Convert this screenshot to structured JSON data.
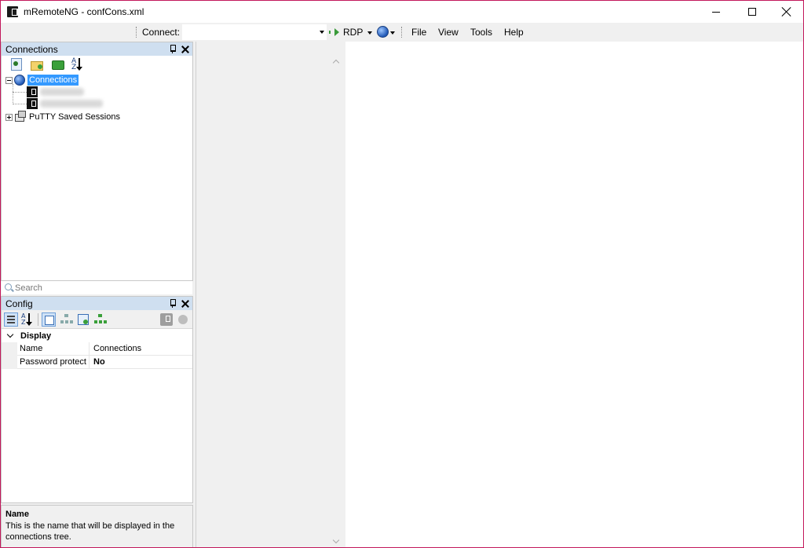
{
  "window": {
    "title": "mRemoteNG - confCons.xml",
    "icon": "mremoteng-app-icon",
    "border_color": "#c2185b"
  },
  "toolbar": {
    "connect_label": "Connect:",
    "connect_value": "",
    "protocol_label": "RDP",
    "protocol_icon": "play-arrow-icon",
    "globe_icon": "globe-icon"
  },
  "menu": {
    "items": [
      "File",
      "View",
      "Tools",
      "Help"
    ]
  },
  "connections_panel": {
    "title": "Connections",
    "toolbar_icons": [
      "new-connection-icon",
      "new-folder-icon",
      "view-icon",
      "sort-az-icon"
    ],
    "sort_glyph_a": "A",
    "sort_glyph_z": "Z",
    "tree": {
      "root_label": "Connections",
      "root_selected": true,
      "hosts": [
        {
          "label": "",
          "blurred": true
        },
        {
          "label": "",
          "blurred": true
        }
      ],
      "putty_label": "PuTTY Saved Sessions"
    },
    "selection_color": "#3399ff"
  },
  "search": {
    "placeholder": "Search",
    "value": ""
  },
  "config_panel": {
    "title": "Config",
    "sort_glyph_a": "A",
    "sort_glyph_z": "Z",
    "category": "Display",
    "properties": [
      {
        "name": "Name",
        "value": "Connections"
      },
      {
        "name": "Password protect",
        "value": "No"
      }
    ]
  },
  "description": {
    "title": "Name",
    "text": "This is the name that will be displayed in the connections tree."
  }
}
